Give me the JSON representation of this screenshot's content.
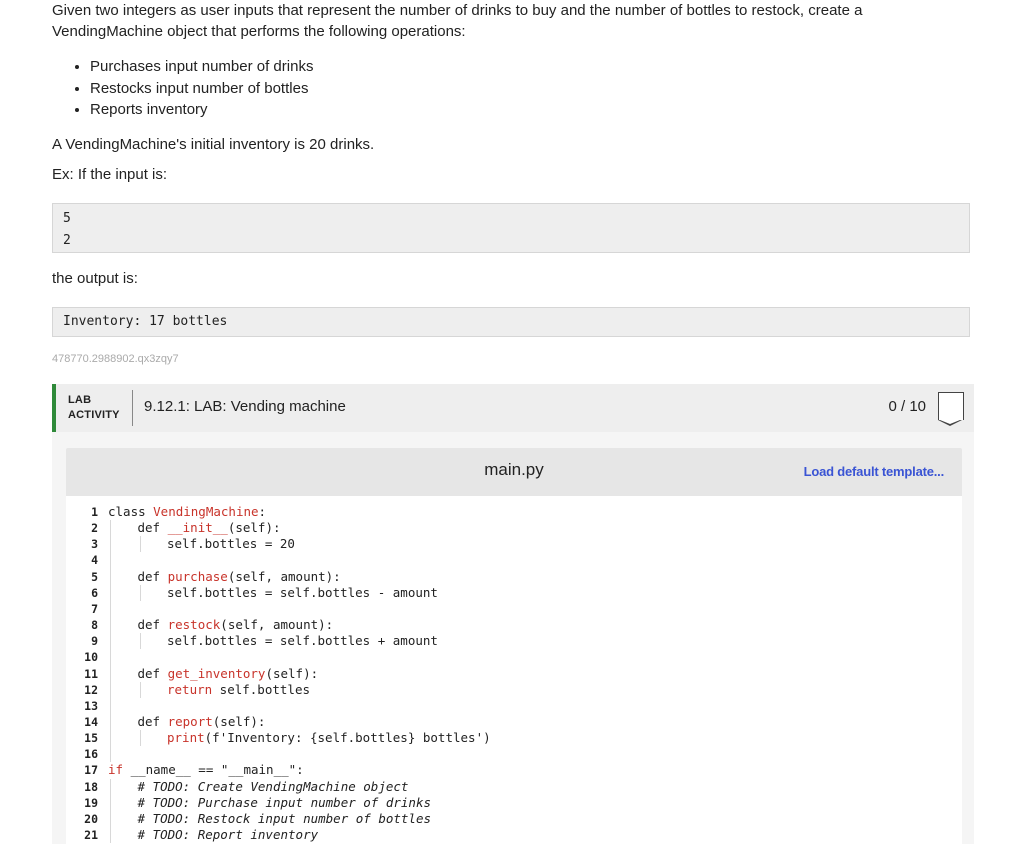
{
  "prompt": {
    "intro": "Given two integers as user inputs that represent the number of drinks to buy and the number of bottles to restock, create a VendingMachine object that performs the following operations:",
    "bullets": [
      "Purchases input number of drinks",
      "Restocks input number of bottles",
      "Reports inventory"
    ],
    "initial": "A VendingMachine's initial inventory is 20 drinks.",
    "example_label": "Ex: If the input is:",
    "input_lines": [
      "5",
      "2"
    ],
    "output_label": "the output is:",
    "output_text": "Inventory: 17 bottles",
    "activity_id": "478770.2988902.qx3zqy7"
  },
  "lab": {
    "tag_line1": "LAB",
    "tag_line2": "ACTIVITY",
    "title": "9.12.1: LAB: Vending machine",
    "score": "0 / 10"
  },
  "editor": {
    "file_name": "main.py",
    "load_template": "Load default template...",
    "lines": [
      {
        "n": "1",
        "indent": 0,
        "parts": [
          {
            "t": "class ",
            "c": "kw"
          },
          {
            "t": "VendingMachine",
            "c": "cls"
          },
          {
            "t": ":",
            "c": ""
          }
        ]
      },
      {
        "n": "2",
        "indent": 1,
        "parts": [
          {
            "t": "def ",
            "c": "kw"
          },
          {
            "t": "__init__",
            "c": "fn"
          },
          {
            "t": "(self):",
            "c": ""
          }
        ]
      },
      {
        "n": "3",
        "indent": 2,
        "parts": [
          {
            "t": "self.bottles = 20",
            "c": ""
          }
        ]
      },
      {
        "n": "4",
        "indent": 0,
        "parts": []
      },
      {
        "n": "5",
        "indent": 1,
        "parts": [
          {
            "t": "def ",
            "c": "kw"
          },
          {
            "t": "purchase",
            "c": "fn"
          },
          {
            "t": "(self, amount):",
            "c": ""
          }
        ]
      },
      {
        "n": "6",
        "indent": 2,
        "parts": [
          {
            "t": "self.bottles = self.bottles - amount",
            "c": ""
          }
        ]
      },
      {
        "n": "7",
        "indent": 0,
        "parts": []
      },
      {
        "n": "8",
        "indent": 1,
        "parts": [
          {
            "t": "def ",
            "c": "kw"
          },
          {
            "t": "restock",
            "c": "fn"
          },
          {
            "t": "(self, amount):",
            "c": ""
          }
        ]
      },
      {
        "n": "9",
        "indent": 2,
        "parts": [
          {
            "t": "self.bottles = self.bottles + amount",
            "c": ""
          }
        ]
      },
      {
        "n": "10",
        "indent": 0,
        "parts": []
      },
      {
        "n": "11",
        "indent": 1,
        "parts": [
          {
            "t": "def ",
            "c": "kw"
          },
          {
            "t": "get_inventory",
            "c": "fn"
          },
          {
            "t": "(self):",
            "c": ""
          }
        ]
      },
      {
        "n": "12",
        "indent": 2,
        "parts": [
          {
            "t": "return",
            "c": "fn"
          },
          {
            "t": " self.bottles",
            "c": ""
          }
        ]
      },
      {
        "n": "13",
        "indent": 0,
        "parts": []
      },
      {
        "n": "14",
        "indent": 1,
        "parts": [
          {
            "t": "def ",
            "c": "kw"
          },
          {
            "t": "report",
            "c": "fn"
          },
          {
            "t": "(self):",
            "c": ""
          }
        ]
      },
      {
        "n": "15",
        "indent": 2,
        "parts": [
          {
            "t": "print",
            "c": "fn"
          },
          {
            "t": "(f'Inventory: {self.bottles} bottles')",
            "c": "str"
          }
        ]
      },
      {
        "n": "16",
        "indent": 0,
        "parts": []
      },
      {
        "n": "17",
        "indent": 0,
        "parts": [
          {
            "t": "if ",
            "c": "fn"
          },
          {
            "t": "__name__ == \"__main__\":",
            "c": ""
          }
        ]
      },
      {
        "n": "18",
        "indent": 1,
        "parts": [
          {
            "t": "# TODO: Create VendingMachine object",
            "c": "cm"
          }
        ]
      },
      {
        "n": "19",
        "indent": 1,
        "parts": [
          {
            "t": "# TODO: Purchase input number of drinks",
            "c": "cm"
          }
        ]
      },
      {
        "n": "20",
        "indent": 1,
        "parts": [
          {
            "t": "# TODO: Restock input number of bottles",
            "c": "cm"
          }
        ]
      },
      {
        "n": "21",
        "indent": 1,
        "parts": [
          {
            "t": "# TODO: Report inventory",
            "c": "cm"
          }
        ]
      }
    ]
  },
  "colors": {
    "accent_green": "#2f8a3a",
    "link_blue": "#3a54d4",
    "code_red": "#c8332a"
  }
}
